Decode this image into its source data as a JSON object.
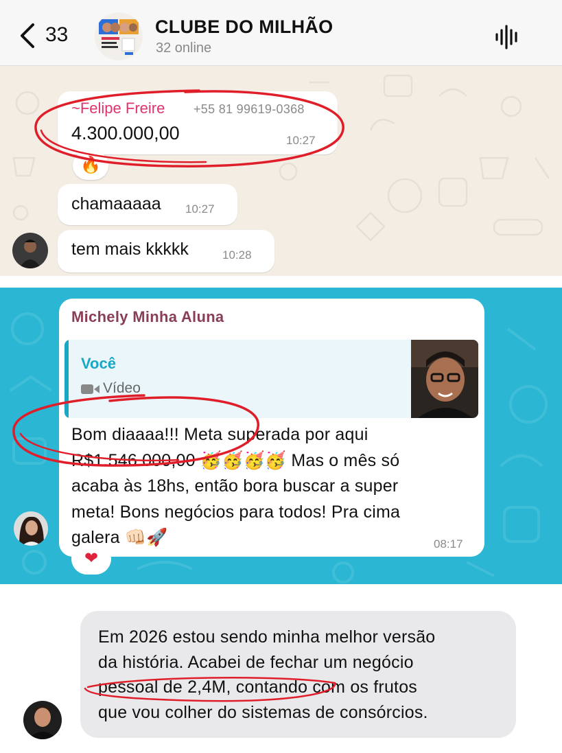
{
  "header": {
    "back_count": "33",
    "group_name": "CLUBE DO MILHÃO",
    "online_status": "32 online"
  },
  "chat1": {
    "message1": {
      "sender": "~Felipe Freire",
      "phone": "+55 81 99619-0368",
      "text": "4.300.000,00",
      "time": "10:27",
      "reaction": "🔥"
    },
    "message2": {
      "text": "chamaaaaa",
      "time": "10:27"
    },
    "message3": {
      "text": "tem mais kkkkk",
      "time": "10:28"
    }
  },
  "chat2": {
    "sender": "Michely Minha Aluna",
    "quote": {
      "author": "Você",
      "type": "Vídeo"
    },
    "lines": [
      "Bom diaaaa!!! Meta superada por aqui",
      "R$1.546.000,00 🥳🥳🥳🥳 Mas o mês só",
      "acaba às 18hs, então bora buscar a super",
      "meta! Bons negócios para todos! Pra cima",
      "galera 👊🏻🚀"
    ],
    "time": "08:17",
    "reaction": "❤"
  },
  "chat3": {
    "lines": [
      "Em 2026 estou sendo minha melhor versão",
      "da história. Acabei de fechar um negócio",
      "pessoal de 2,4M, contando com os frutos",
      "que vou colher do sistemas de consórcios."
    ]
  },
  "colors": {
    "sender_pink": "#e0336e",
    "sender_maroon": "#8a3e55",
    "quote_teal": "#19a7c6",
    "chat_beige": "#f3ede4",
    "chat_teal": "#2bb6d3",
    "annotation_red": "#e01e2a"
  }
}
